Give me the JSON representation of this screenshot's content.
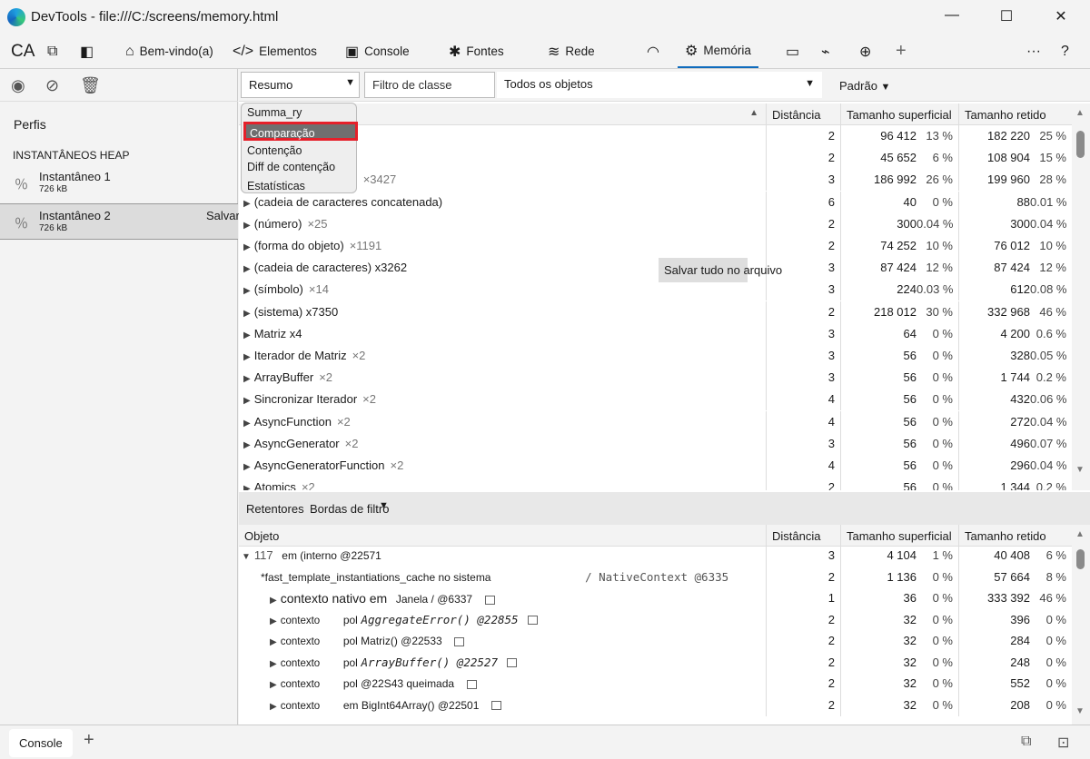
{
  "window": {
    "title": "DevTools - file:///C:/screens/memory.html",
    "minimize": "—",
    "maximize": "☐",
    "close": "✕"
  },
  "tabs": [
    {
      "label": "",
      "icon": "CA"
    },
    {
      "label": "Bem-vindo(a)",
      "icon": "⌂"
    },
    {
      "label": "Elementos",
      "icon": "</>"
    },
    {
      "label": "Console",
      "icon": "▣"
    },
    {
      "label": "Fontes",
      "icon": "✱"
    },
    {
      "label": "Rede",
      "icon": "≋"
    },
    {
      "label": "Memória",
      "icon": "⚙"
    }
  ],
  "tab_more": "···",
  "tab_help": "?",
  "tab_add": "+",
  "left": {
    "profiles_label": "Perfis",
    "heap_label": "INSTANTÂNEOS HEAP",
    "snapshots": [
      {
        "name": "Instantâneo 1",
        "size": "726 kB"
      },
      {
        "name": "Instantâneo 2",
        "size": "726 kB",
        "save": "Salvar"
      }
    ]
  },
  "toolbar": {
    "view": "Resumo",
    "class_filter_placeholder": "Filtro de classe",
    "objects": "Todos os objetos",
    "ordering": "Padrão"
  },
  "dropdown": {
    "items": [
      "Summa_ry",
      "Comparação",
      "Contenção",
      "Diff de contenção",
      "Estatísticas"
    ],
    "highlighted": "Comparação"
  },
  "upper": {
    "headers": [
      "",
      "Distância",
      "Tamanho superficial",
      "Tamanho retido"
    ],
    "save_all": "Salvar tudo no arquivo",
    "rows": [
      {
        "name": "",
        "count": "",
        "dist": "2",
        "shallow": "96 412",
        "sp": "13 %",
        "retained": "182 220",
        "rp": "25 %"
      },
      {
        "name": "",
        "count": "",
        "dist": "2",
        "shallow": "45 652",
        "sp": "6 %",
        "retained": "108 904",
        "rp": "15 %"
      },
      {
        "name": "",
        "count": "×3427",
        "dist": "3",
        "shallow": "186 992",
        "sp": "26 %",
        "retained": "199 960",
        "rp": "28 %"
      },
      {
        "name": "(cadeia de caracteres concatenada)",
        "count": "",
        "dist": "6",
        "shallow": "40",
        "sp": "0 %",
        "retained": "88",
        "rp": "0.01 %"
      },
      {
        "name": "(número)",
        "count": "×25",
        "dist": "2",
        "shallow": "300",
        "sp": "0.04 %",
        "retained": "300",
        "rp": "0.04 %"
      },
      {
        "name": "(forma do objeto)",
        "count": "×1191",
        "dist": "2",
        "shallow": "74 252",
        "sp": "10 %",
        "retained": "76 012",
        "rp": "10 %"
      },
      {
        "name": "(cadeia de caracteres) x3262",
        "count": "",
        "dist": "3",
        "shallow": "87 424",
        "sp": "12 %",
        "retained": "87 424",
        "rp": "12 %"
      },
      {
        "name": "(símbolo)",
        "count": "×14",
        "dist": "3",
        "shallow": "224",
        "sp": "0.03 %",
        "retained": "612",
        "rp": "0.08 %"
      },
      {
        "name": "(sistema) x7350",
        "count": "",
        "dist": "2",
        "shallow": "218 012",
        "sp": "30 %",
        "retained": "332 968",
        "rp": "46 %"
      },
      {
        "name": "Matriz x4",
        "count": "",
        "dist": "3",
        "shallow": "64",
        "sp": "0 %",
        "retained": "4 200",
        "rp": "0.6 %"
      },
      {
        "name": "Iterador de Matriz",
        "count": "×2",
        "dist": "3",
        "shallow": "56",
        "sp": "0 %",
        "retained": "328",
        "rp": "0.05 %"
      },
      {
        "name": "ArrayBuffer",
        "count": "×2",
        "dist": "3",
        "shallow": "56",
        "sp": "0 %",
        "retained": "1 744",
        "rp": "0.2 %"
      },
      {
        "name": "Sincronizar Iterador",
        "count": "×2",
        "dist": "4",
        "shallow": "56",
        "sp": "0 %",
        "retained": "432",
        "rp": "0.06 %"
      },
      {
        "name": "AsyncFunction",
        "count": "×2",
        "dist": "4",
        "shallow": "56",
        "sp": "0 %",
        "retained": "272",
        "rp": "0.04 %"
      },
      {
        "name": "AsyncGenerator",
        "count": "×2",
        "dist": "3",
        "shallow": "56",
        "sp": "0 %",
        "retained": "496",
        "rp": "0.07 %"
      },
      {
        "name": "AsyncGeneratorFunction",
        "count": "×2",
        "dist": "4",
        "shallow": "56",
        "sp": "0 %",
        "retained": "296",
        "rp": "0.04 %"
      },
      {
        "name": "Atomics",
        "count": "×2",
        "dist": "2",
        "shallow": "56",
        "sp": "0 %",
        "retained": "1 344",
        "rp": "0.2 %"
      }
    ]
  },
  "lower": {
    "tab_retainers": "Retentores",
    "tab_filter": "Bordas de filtro",
    "headers": [
      "Objeto",
      "Distância",
      "Tamanho superficial",
      "Tamanho retido"
    ],
    "rows": [
      {
        "prefix": "117",
        "text": "em (interno @22571",
        "code": "",
        "dist": "3",
        "shallow": "4 104",
        "sp": "1 %",
        "retained": "40 408",
        "rp": "6 %"
      },
      {
        "prefix": "",
        "text": "*fast_template_instantiations_cache no sistema",
        "code": "/ NativeContext @6335",
        "dist": "2",
        "shallow": "1 136",
        "sp": "0 %",
        "retained": "57 664",
        "rp": "8 %"
      },
      {
        "prefix": "contexto nativo em",
        "text": "Janela / @6337",
        "code": "",
        "dist": "1",
        "shallow": "36",
        "sp": "0 %",
        "retained": "333 392",
        "rp": "46 %"
      },
      {
        "prefix": "contexto",
        "text": "pol",
        "code": "AggregateError() @22855",
        "dist": "2",
        "shallow": "32",
        "sp": "0 %",
        "retained": "396",
        "rp": "0 %"
      },
      {
        "prefix": "contexto",
        "text": "pol Matriz() @22533",
        "code": "",
        "dist": "2",
        "shallow": "32",
        "sp": "0 %",
        "retained": "284",
        "rp": "0 %"
      },
      {
        "prefix": "contexto",
        "text": "pol",
        "code": "ArrayBuffer() @22527",
        "dist": "2",
        "shallow": "32",
        "sp": "0 %",
        "retained": "248",
        "rp": "0 %"
      },
      {
        "prefix": "contexto",
        "text": "pol @22S43 queimada",
        "code": "",
        "dist": "2",
        "shallow": "32",
        "sp": "0 %",
        "retained": "552",
        "rp": "0 %"
      },
      {
        "prefix": "contexto",
        "text": "em BigInt64Array() @22501",
        "code": "",
        "dist": "2",
        "shallow": "32",
        "sp": "0 %",
        "retained": "208",
        "rp": "0 %"
      }
    ]
  },
  "status": {
    "console": "Console",
    "add": "+"
  }
}
